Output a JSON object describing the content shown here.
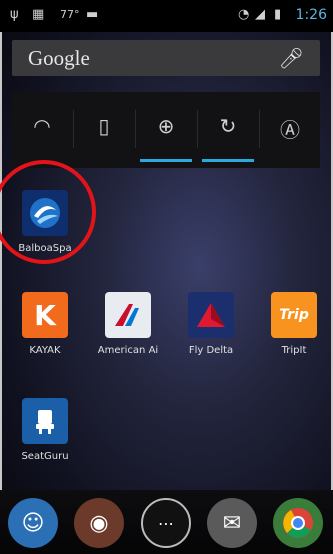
{
  "status_bar": {
    "temperature": "77°",
    "time": "1:26"
  },
  "search": {
    "label": "Google"
  },
  "quick_settings": [
    "wifi",
    "vibrate",
    "location",
    "sync",
    "auto-brightness"
  ],
  "apps": [
    {
      "label": "BalboaSpa",
      "icon": "balboa-spa-icon"
    },
    {
      "label": "KAYAK",
      "icon": "kayak-icon",
      "badge": "K"
    },
    {
      "label": "American Ai",
      "icon": "american-airlines-icon"
    },
    {
      "label": "Fly Delta",
      "icon": "delta-icon"
    },
    {
      "label": "TripIt",
      "icon": "tripit-icon",
      "badge": "Trip"
    },
    {
      "label": "SeatGuru",
      "icon": "seatguru-icon"
    }
  ],
  "dock": [
    "contacts-icon",
    "camera-icon",
    "all-apps-icon",
    "messaging-icon",
    "chrome-icon"
  ],
  "colors": {
    "highlight": "#e2141a",
    "accent": "#2aa8e0"
  }
}
